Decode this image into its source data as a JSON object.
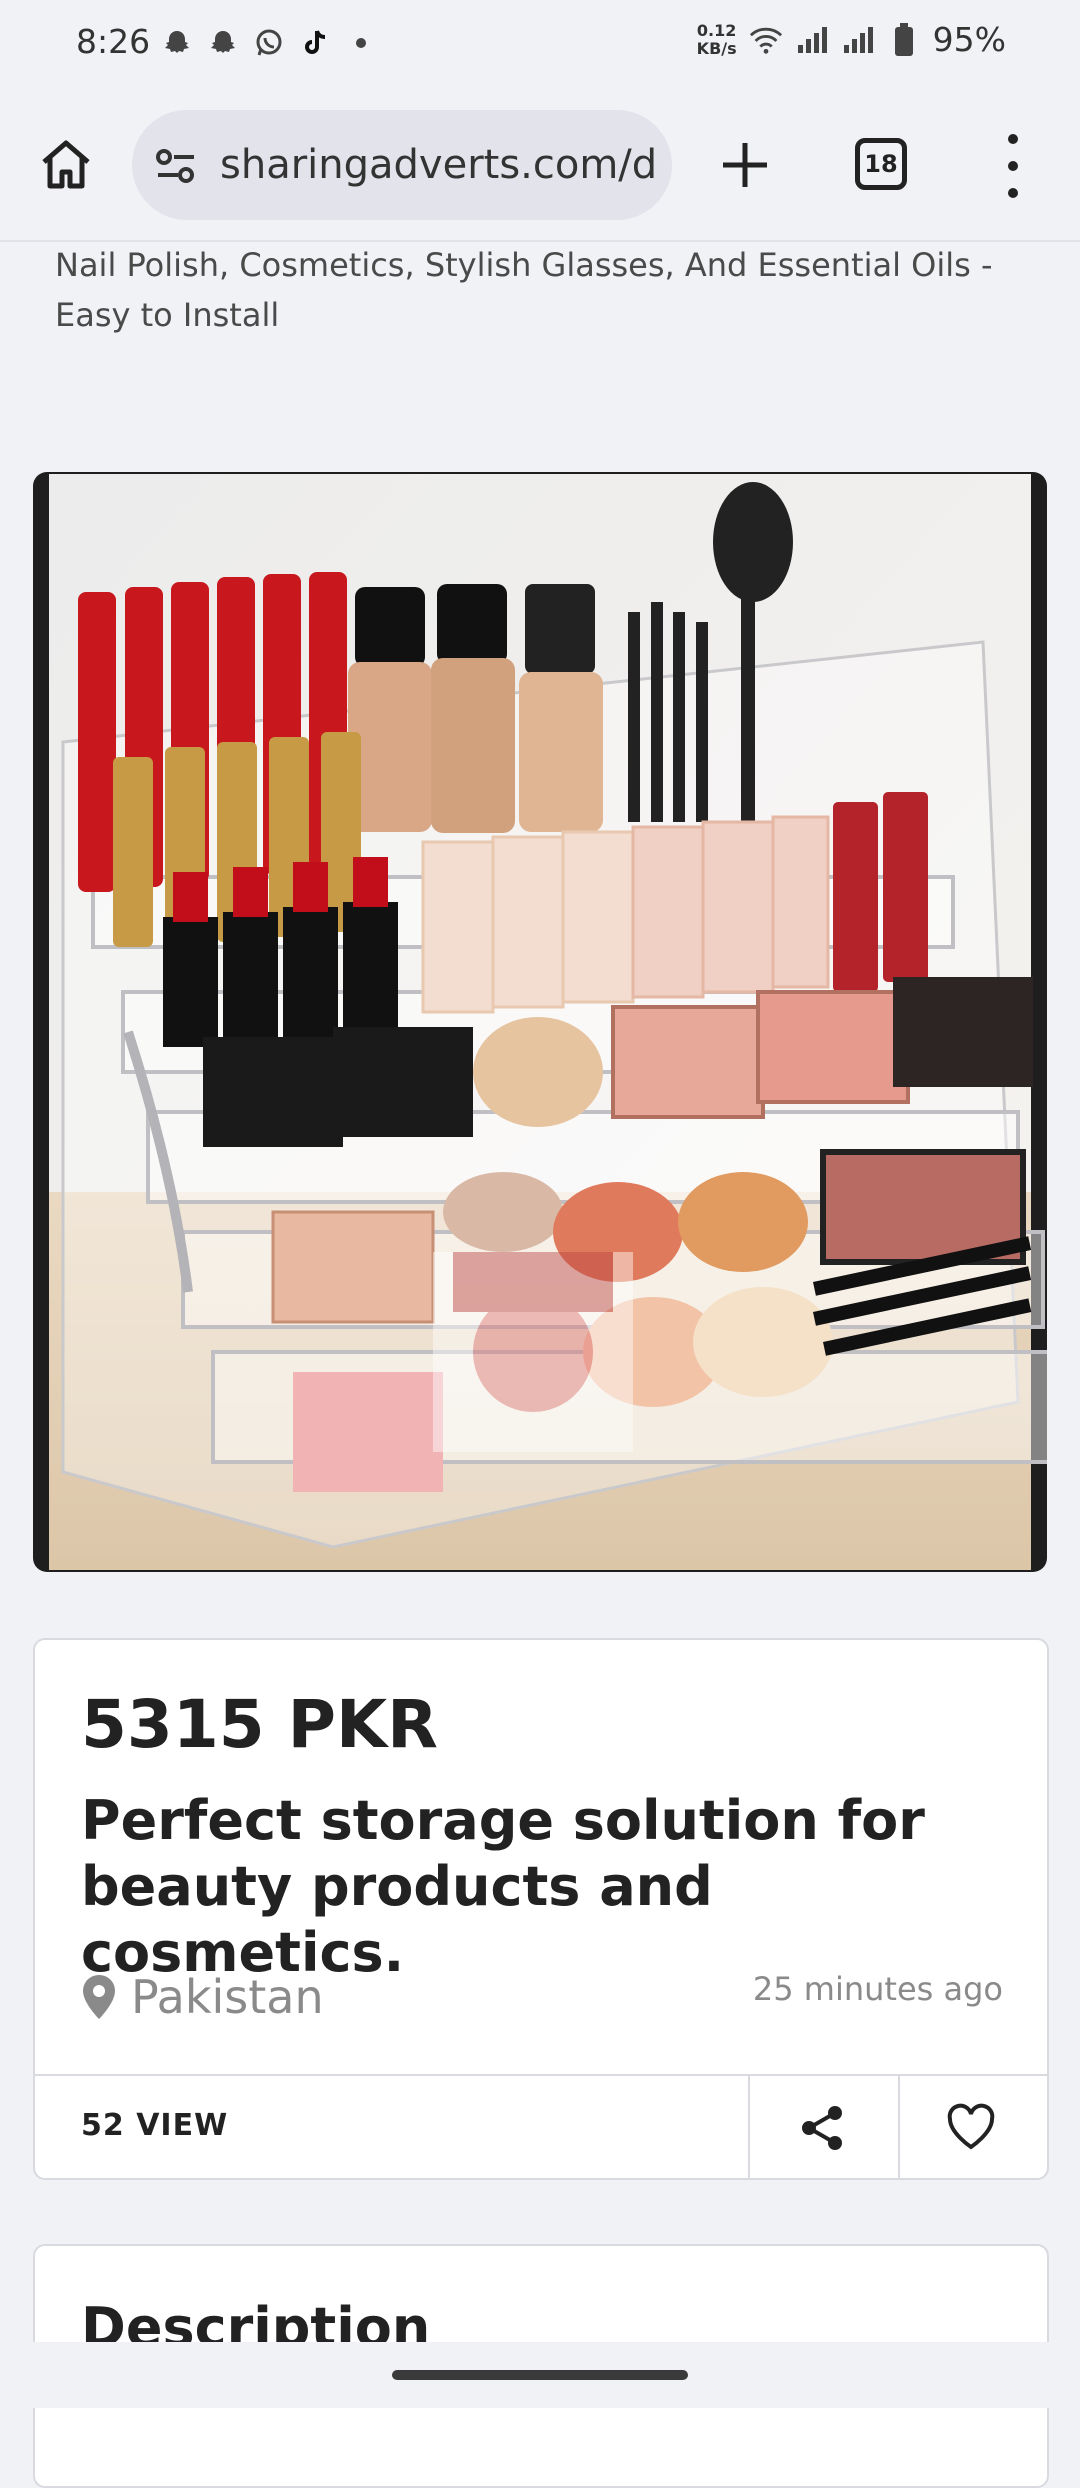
{
  "status_bar": {
    "time": "8:26",
    "icons_left": [
      "snapchat-icon",
      "snapchat-icon",
      "whatsapp-icon",
      "tiktok-icon",
      "dot-icon"
    ],
    "net_speed_value": "0.12",
    "net_speed_unit": "KB/s",
    "battery": "95%"
  },
  "browser": {
    "url": "sharingadverts.com/d",
    "tab_count": "18"
  },
  "page": {
    "subtitle_text": "Nail Polish, Cosmetics, Stylish Glasses, And Essential Oils - Easy to Install"
  },
  "listing": {
    "price": "5315 PKR",
    "title": "Perfect storage solution for beauty products and cosmetics.",
    "location": "Pakistan",
    "posted": "25 minutes ago",
    "views": "52 VIEW"
  },
  "description": {
    "heading": "Description"
  },
  "colors": {
    "background": "#f1f2f6",
    "text": "#222222",
    "muted": "#8a8a8a"
  }
}
